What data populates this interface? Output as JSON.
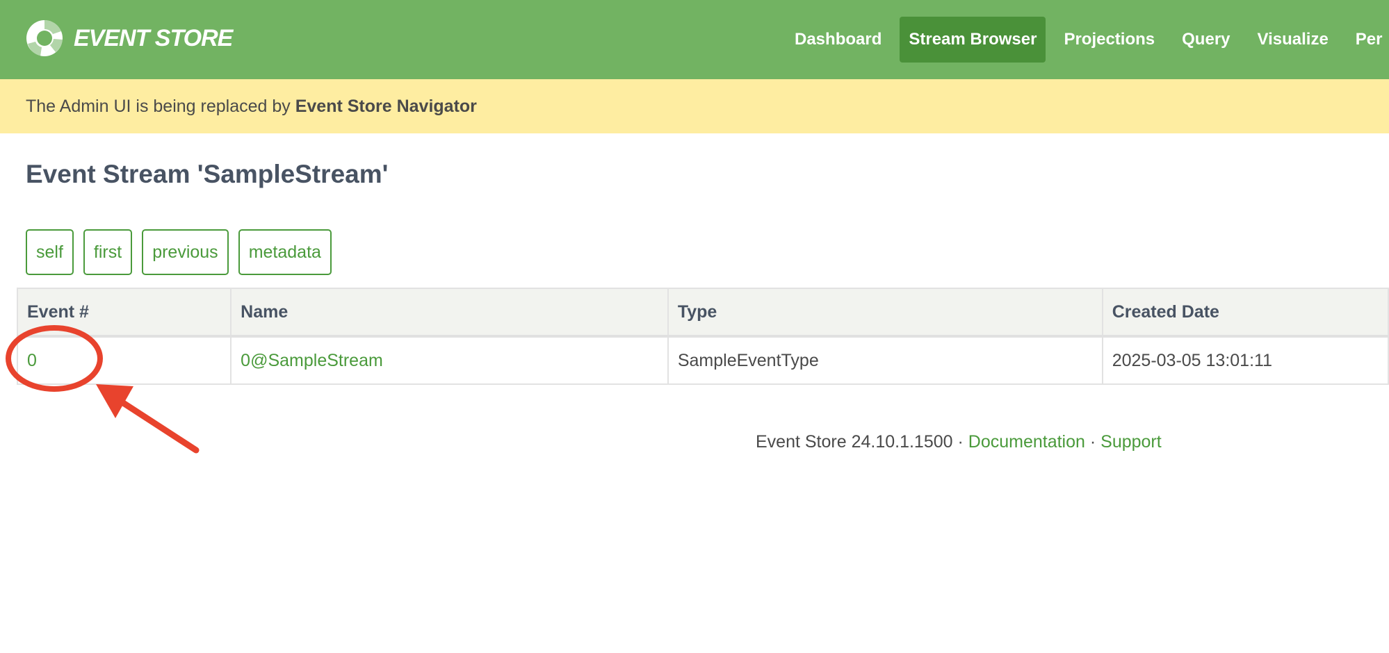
{
  "brand": {
    "name": "EVENT STORE"
  },
  "nav": {
    "items": [
      {
        "label": "Dashboard",
        "active": false
      },
      {
        "label": "Stream Browser",
        "active": true
      },
      {
        "label": "Projections",
        "active": false
      },
      {
        "label": "Query",
        "active": false
      },
      {
        "label": "Visualize",
        "active": false
      },
      {
        "label": "Per",
        "active": false
      }
    ]
  },
  "banner": {
    "text": "The Admin UI is being replaced by ",
    "highlight": "Event Store Navigator"
  },
  "page": {
    "title": "Event Stream 'SampleStream'"
  },
  "links": {
    "self": "self",
    "first": "first",
    "previous": "previous",
    "metadata": "metadata"
  },
  "table": {
    "headers": {
      "event": "Event #",
      "name": "Name",
      "type": "Type",
      "created": "Created Date"
    },
    "rows": [
      {
        "event": "0",
        "name": "0@SampleStream",
        "type": "SampleEventType",
        "created": "2025-03-05 13:01:11"
      }
    ]
  },
  "footer": {
    "version": "Event Store 24.10.1.1500",
    "separator": " · ",
    "documentation": "Documentation",
    "support": "Support"
  },
  "annotation": {
    "color": "#e8432d",
    "target": "event-number-link"
  },
  "colors": {
    "navbar": "#72b362",
    "nav_active": "#4a9139",
    "banner": "#feeda1",
    "link": "#4a9a3b"
  }
}
